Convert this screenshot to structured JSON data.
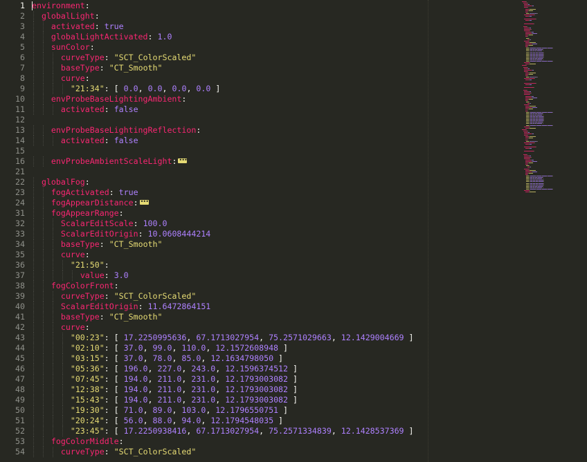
{
  "editor": {
    "lines": [
      {
        "n": "1",
        "indent": 0,
        "current": true,
        "tokens": [
          [
            "k",
            "environment"
          ],
          [
            "p",
            ":"
          ]
        ]
      },
      {
        "n": "2",
        "indent": 1,
        "tokens": [
          [
            "k",
            "globalLight"
          ],
          [
            "p",
            ":"
          ]
        ]
      },
      {
        "n": "3",
        "indent": 2,
        "tokens": [
          [
            "k",
            "activated"
          ],
          [
            "p",
            ": "
          ],
          [
            "n",
            "true"
          ]
        ]
      },
      {
        "n": "4",
        "indent": 2,
        "tokens": [
          [
            "k",
            "globalLightActivated"
          ],
          [
            "p",
            ": "
          ],
          [
            "n",
            "1.0"
          ]
        ]
      },
      {
        "n": "5",
        "indent": 2,
        "tokens": [
          [
            "k",
            "sunColor"
          ],
          [
            "p",
            ":"
          ]
        ]
      },
      {
        "n": "6",
        "indent": 3,
        "tokens": [
          [
            "k",
            "curveType"
          ],
          [
            "p",
            ": "
          ],
          [
            "s",
            "\"SCT_ColorScaled\""
          ]
        ]
      },
      {
        "n": "7",
        "indent": 3,
        "tokens": [
          [
            "k",
            "baseType"
          ],
          [
            "p",
            ": "
          ],
          [
            "s",
            "\"CT_Smooth\""
          ]
        ]
      },
      {
        "n": "8",
        "indent": 3,
        "tokens": [
          [
            "k",
            "curve"
          ],
          [
            "p",
            ":"
          ]
        ]
      },
      {
        "n": "9",
        "indent": 4,
        "tokens": [
          [
            "s",
            "\"21:34\""
          ],
          [
            "p",
            ": [ "
          ],
          [
            "n",
            "0.0"
          ],
          [
            "p",
            ", "
          ],
          [
            "n",
            "0.0"
          ],
          [
            "p",
            ", "
          ],
          [
            "n",
            "0.0"
          ],
          [
            "p",
            ", "
          ],
          [
            "n",
            "0.0"
          ],
          [
            "p",
            " ]"
          ]
        ]
      },
      {
        "n": "10",
        "indent": 2,
        "tokens": [
          [
            "k",
            "envProbeBaseLightingAmbient"
          ],
          [
            "p",
            ":"
          ]
        ]
      },
      {
        "n": "11",
        "indent": 3,
        "tokens": [
          [
            "k",
            "activated"
          ],
          [
            "p",
            ": "
          ],
          [
            "n",
            "false"
          ]
        ]
      },
      {
        "n": "12",
        "indent": 0,
        "tokens": []
      },
      {
        "n": "13",
        "indent": 2,
        "tokens": [
          [
            "k",
            "envProbeBaseLightingReflection"
          ],
          [
            "p",
            ":"
          ]
        ]
      },
      {
        "n": "14",
        "indent": 3,
        "tokens": [
          [
            "k",
            "activated"
          ],
          [
            "p",
            ": "
          ],
          [
            "n",
            "false"
          ]
        ]
      },
      {
        "n": "15",
        "indent": 0,
        "tokens": []
      },
      {
        "n": "16",
        "indent": 2,
        "tokens": [
          [
            "k",
            "envProbeAmbientScaleLight"
          ],
          [
            "p",
            ":"
          ]
        ],
        "fold": true
      },
      {
        "n": "21",
        "indent": 0,
        "tokens": []
      },
      {
        "n": "22",
        "indent": 1,
        "tokens": [
          [
            "k",
            "globalFog"
          ],
          [
            "p",
            ":"
          ]
        ]
      },
      {
        "n": "23",
        "indent": 2,
        "tokens": [
          [
            "k",
            "fogActivated"
          ],
          [
            "p",
            ": "
          ],
          [
            "n",
            "true"
          ]
        ]
      },
      {
        "n": "24",
        "indent": 2,
        "tokens": [
          [
            "k",
            "fogAppearDistance"
          ],
          [
            "p",
            ":"
          ]
        ],
        "fold": true
      },
      {
        "n": "31",
        "indent": 2,
        "tokens": [
          [
            "k",
            "fogAppearRange"
          ],
          [
            "p",
            ":"
          ]
        ]
      },
      {
        "n": "32",
        "indent": 3,
        "tokens": [
          [
            "k",
            "ScalarEditScale"
          ],
          [
            "p",
            ": "
          ],
          [
            "n",
            "100.0"
          ]
        ]
      },
      {
        "n": "33",
        "indent": 3,
        "tokens": [
          [
            "k",
            "ScalarEditOrigin"
          ],
          [
            "p",
            ": "
          ],
          [
            "n",
            "10.0608444214"
          ]
        ]
      },
      {
        "n": "34",
        "indent": 3,
        "tokens": [
          [
            "k",
            "baseType"
          ],
          [
            "p",
            ": "
          ],
          [
            "s",
            "\"CT_Smooth\""
          ]
        ]
      },
      {
        "n": "35",
        "indent": 3,
        "tokens": [
          [
            "k",
            "curve"
          ],
          [
            "p",
            ":"
          ]
        ]
      },
      {
        "n": "36",
        "indent": 4,
        "tokens": [
          [
            "s",
            "\"21:50\""
          ],
          [
            "p",
            ":"
          ]
        ]
      },
      {
        "n": "37",
        "indent": 5,
        "tokens": [
          [
            "k",
            "value"
          ],
          [
            "p",
            ": "
          ],
          [
            "n",
            "3.0"
          ]
        ]
      },
      {
        "n": "38",
        "indent": 2,
        "tokens": [
          [
            "k",
            "fogColorFront"
          ],
          [
            "p",
            ":"
          ]
        ]
      },
      {
        "n": "39",
        "indent": 3,
        "tokens": [
          [
            "k",
            "curveType"
          ],
          [
            "p",
            ": "
          ],
          [
            "s",
            "\"SCT_ColorScaled\""
          ]
        ]
      },
      {
        "n": "40",
        "indent": 3,
        "tokens": [
          [
            "k",
            "ScalarEditOrigin"
          ],
          [
            "p",
            ": "
          ],
          [
            "n",
            "11.6472864151"
          ]
        ]
      },
      {
        "n": "41",
        "indent": 3,
        "tokens": [
          [
            "k",
            "baseType"
          ],
          [
            "p",
            ": "
          ],
          [
            "s",
            "\"CT_Smooth\""
          ]
        ]
      },
      {
        "n": "42",
        "indent": 3,
        "tokens": [
          [
            "k",
            "curve"
          ],
          [
            "p",
            ":"
          ]
        ]
      },
      {
        "n": "43",
        "indent": 4,
        "tokens": [
          [
            "s",
            "\"00:23\""
          ],
          [
            "p",
            ": [ "
          ],
          [
            "n",
            "17.2250995636"
          ],
          [
            "p",
            ", "
          ],
          [
            "n",
            "67.1713027954"
          ],
          [
            "p",
            ", "
          ],
          [
            "n",
            "75.2571029663"
          ],
          [
            "p",
            ", "
          ],
          [
            "n",
            "12.1429004669"
          ],
          [
            "p",
            " ]"
          ]
        ]
      },
      {
        "n": "44",
        "indent": 4,
        "tokens": [
          [
            "s",
            "\"02:10\""
          ],
          [
            "p",
            ": [ "
          ],
          [
            "n",
            "37.0"
          ],
          [
            "p",
            ", "
          ],
          [
            "n",
            "99.0"
          ],
          [
            "p",
            ", "
          ],
          [
            "n",
            "110.0"
          ],
          [
            "p",
            ", "
          ],
          [
            "n",
            "12.1572608948"
          ],
          [
            "p",
            " ]"
          ]
        ]
      },
      {
        "n": "45",
        "indent": 4,
        "tokens": [
          [
            "s",
            "\"03:15\""
          ],
          [
            "p",
            ": [ "
          ],
          [
            "n",
            "37.0"
          ],
          [
            "p",
            ", "
          ],
          [
            "n",
            "78.0"
          ],
          [
            "p",
            ", "
          ],
          [
            "n",
            "85.0"
          ],
          [
            "p",
            ", "
          ],
          [
            "n",
            "12.1634798050"
          ],
          [
            "p",
            " ]"
          ]
        ]
      },
      {
        "n": "46",
        "indent": 4,
        "tokens": [
          [
            "s",
            "\"05:36\""
          ],
          [
            "p",
            ": [ "
          ],
          [
            "n",
            "196.0"
          ],
          [
            "p",
            ", "
          ],
          [
            "n",
            "227.0"
          ],
          [
            "p",
            ", "
          ],
          [
            "n",
            "243.0"
          ],
          [
            "p",
            ", "
          ],
          [
            "n",
            "12.1596374512"
          ],
          [
            "p",
            " ]"
          ]
        ]
      },
      {
        "n": "47",
        "indent": 4,
        "tokens": [
          [
            "s",
            "\"07:45\""
          ],
          [
            "p",
            ": [ "
          ],
          [
            "n",
            "194.0"
          ],
          [
            "p",
            ", "
          ],
          [
            "n",
            "211.0"
          ],
          [
            "p",
            ", "
          ],
          [
            "n",
            "231.0"
          ],
          [
            "p",
            ", "
          ],
          [
            "n",
            "12.1793003082"
          ],
          [
            "p",
            " ]"
          ]
        ]
      },
      {
        "n": "48",
        "indent": 4,
        "tokens": [
          [
            "s",
            "\"12:38\""
          ],
          [
            "p",
            ": [ "
          ],
          [
            "n",
            "194.0"
          ],
          [
            "p",
            ", "
          ],
          [
            "n",
            "211.0"
          ],
          [
            "p",
            ", "
          ],
          [
            "n",
            "231.0"
          ],
          [
            "p",
            ", "
          ],
          [
            "n",
            "12.1793003082"
          ],
          [
            "p",
            " ]"
          ]
        ]
      },
      {
        "n": "49",
        "indent": 4,
        "tokens": [
          [
            "s",
            "\"15:43\""
          ],
          [
            "p",
            ": [ "
          ],
          [
            "n",
            "194.0"
          ],
          [
            "p",
            ", "
          ],
          [
            "n",
            "211.0"
          ],
          [
            "p",
            ", "
          ],
          [
            "n",
            "231.0"
          ],
          [
            "p",
            ", "
          ],
          [
            "n",
            "12.1793003082"
          ],
          [
            "p",
            " ]"
          ]
        ]
      },
      {
        "n": "50",
        "indent": 4,
        "tokens": [
          [
            "s",
            "\"19:30\""
          ],
          [
            "p",
            ": [ "
          ],
          [
            "n",
            "71.0"
          ],
          [
            "p",
            ", "
          ],
          [
            "n",
            "89.0"
          ],
          [
            "p",
            ", "
          ],
          [
            "n",
            "103.0"
          ],
          [
            "p",
            ", "
          ],
          [
            "n",
            "12.1796550751"
          ],
          [
            "p",
            " ]"
          ]
        ]
      },
      {
        "n": "51",
        "indent": 4,
        "tokens": [
          [
            "s",
            "\"20:24\""
          ],
          [
            "p",
            ": [ "
          ],
          [
            "n",
            "56.0"
          ],
          [
            "p",
            ", "
          ],
          [
            "n",
            "88.0"
          ],
          [
            "p",
            ", "
          ],
          [
            "n",
            "94.0"
          ],
          [
            "p",
            ", "
          ],
          [
            "n",
            "12.1794548035"
          ],
          [
            "p",
            " ]"
          ]
        ]
      },
      {
        "n": "52",
        "indent": 4,
        "tokens": [
          [
            "s",
            "\"23:45\""
          ],
          [
            "p",
            ": [ "
          ],
          [
            "n",
            "17.2250938416"
          ],
          [
            "p",
            ", "
          ],
          [
            "n",
            "67.1713027954"
          ],
          [
            "p",
            ", "
          ],
          [
            "n",
            "75.2571334839"
          ],
          [
            "p",
            ", "
          ],
          [
            "n",
            "12.1428537369"
          ],
          [
            "p",
            " ]"
          ]
        ]
      },
      {
        "n": "53",
        "indent": 2,
        "tokens": [
          [
            "k",
            "fogColorMiddle"
          ],
          [
            "p",
            ":"
          ]
        ]
      },
      {
        "n": "54",
        "indent": 3,
        "tokens": [
          [
            "k",
            "curveType"
          ],
          [
            "p",
            ": "
          ],
          [
            "s",
            "\"SCT_ColorScaled\""
          ]
        ]
      }
    ]
  },
  "colors": {
    "background": "#272822",
    "key": "#f92672",
    "string": "#e6db74",
    "number": "#ae81ff",
    "text": "#f8f8f2",
    "gutter": "#8f908a"
  }
}
